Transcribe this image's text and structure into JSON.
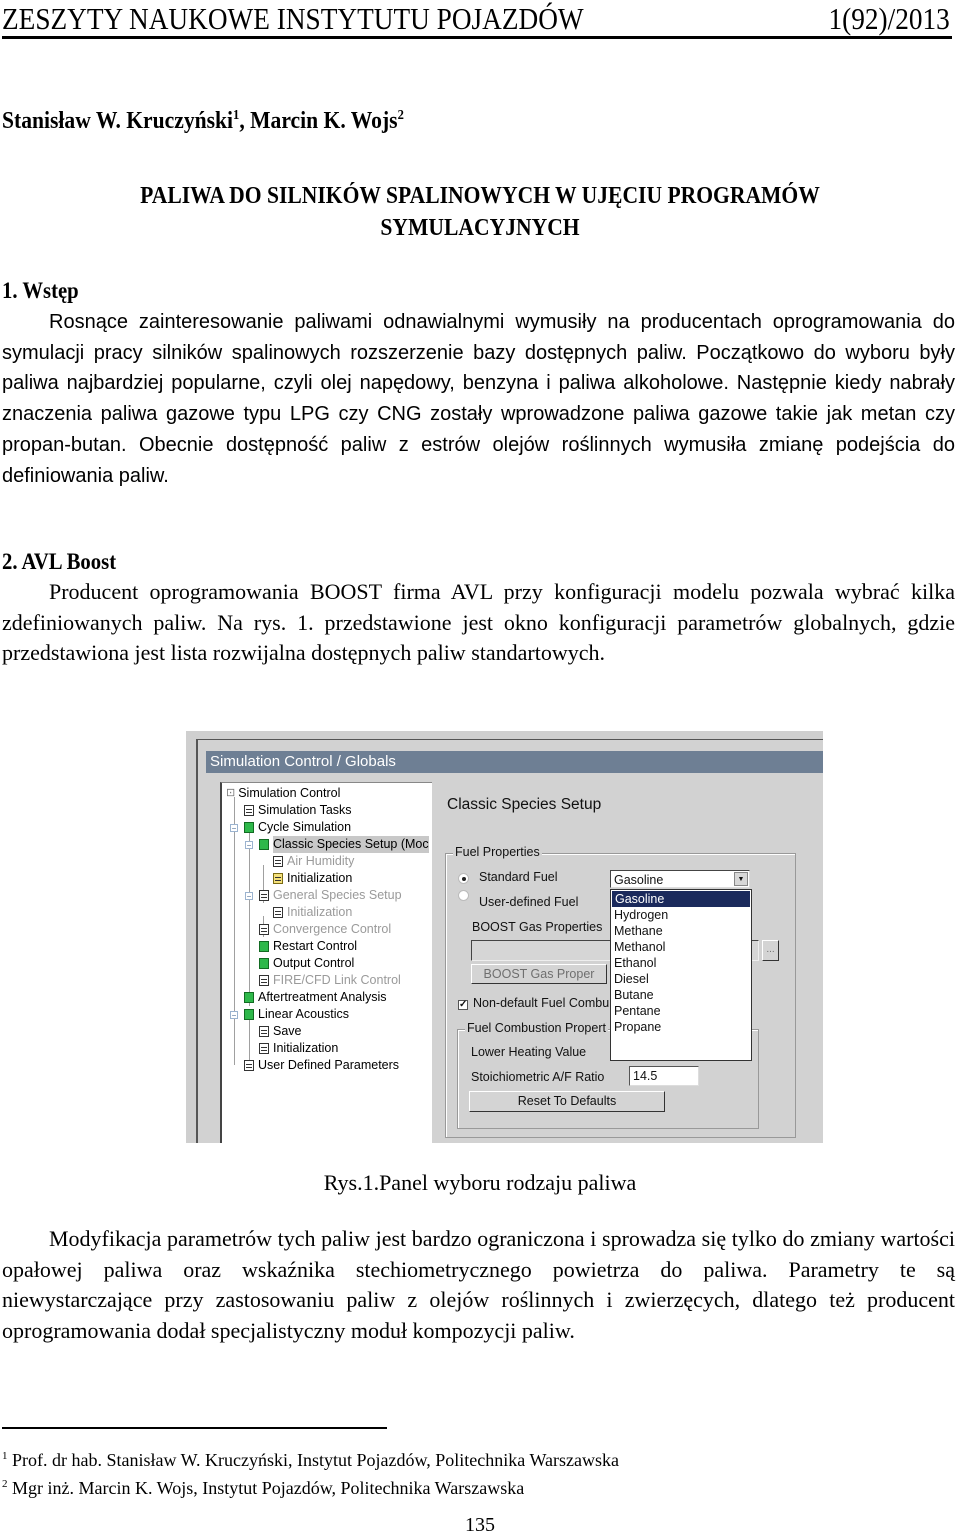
{
  "header": {
    "journal": "ZESZYTY NAUKOWE INSTYTUTU POJAZDÓW",
    "issue": "1(92)/2013"
  },
  "authors": {
    "author1": "Stanisław W. Kruczyński",
    "author1_mark": "1",
    "separator": ", ",
    "author2": "Marcin K. Wojs",
    "author2_mark": "2"
  },
  "title": {
    "line1": "PALIWA DO SILNIKÓW SPALINOWYCH W UJĘCIU PROGRAMÓW",
    "line2": "SYMULACYJNYCH"
  },
  "sections": [
    {
      "heading": "1. Wstęp",
      "text": "Rosnące zainteresowanie paliwami odnawialnymi wymusiły na producentach oprogramowania do symulacji pracy silników spalinowych rozszerzenie bazy dostępnych paliw. Początkowo do wyboru były paliwa najbardziej popularne, czyli olej napędowy, benzyna i paliwa alkoholowe. Następnie kiedy nabrały znaczenia paliwa gazowe typu LPG czy CNG zostały wprowadzone paliwa gazowe takie jak metan czy propan-butan. Obecnie dostępność paliw z estrów olejów roślinnych wymusiła zmianę podejścia do definiowania paliw."
    },
    {
      "heading": "2. AVL Boost",
      "text": "Producent oprogramowania BOOST firma AVL  przy konfiguracji modelu pozwala wybrać kilka zdefiniowanych paliw. Na rys. 1. przedstawione jest okno konfiguracji parametrów globalnych, gdzie przedstawiona jest lista rozwijalna dostępnych paliw standartowych."
    }
  ],
  "figure": {
    "window_title": "Simulation Control / Globals",
    "tree": [
      {
        "label": "Simulation Control",
        "icon": "tree-root-icon",
        "state": "normal"
      },
      {
        "label": "Simulation Tasks",
        "icon": "page-icon",
        "state": "normal"
      },
      {
        "label": "Cycle Simulation",
        "icon": "green-page-icon",
        "state": "normal"
      },
      {
        "label": "Classic Species Setup (Moc",
        "icon": "green-page-icon",
        "state": "selected"
      },
      {
        "label": "Air Humidity",
        "icon": "page-icon",
        "state": "disabled"
      },
      {
        "label": "Initialization",
        "icon": "yellow-table-icon",
        "state": "normal"
      },
      {
        "label": "General Species Setup",
        "icon": "table-icon",
        "state": "disabled"
      },
      {
        "label": "Initialization",
        "icon": "table-icon",
        "state": "disabled"
      },
      {
        "label": "Convergence Control",
        "icon": "table-icon",
        "state": "disabled"
      },
      {
        "label": "Restart Control",
        "icon": "green-page-icon",
        "state": "normal"
      },
      {
        "label": "Output Control",
        "icon": "green-page-icon",
        "state": "normal"
      },
      {
        "label": "FIRE/CFD Link Control",
        "icon": "page-icon",
        "state": "disabled"
      },
      {
        "label": "Aftertreatment Analysis",
        "icon": "green-page-icon",
        "state": "normal"
      },
      {
        "label": "Linear Acoustics",
        "icon": "green-page-icon",
        "state": "normal"
      },
      {
        "label": "Save",
        "icon": "table-icon",
        "state": "normal"
      },
      {
        "label": "Initialization",
        "icon": "table-icon",
        "state": "normal"
      },
      {
        "label": "User Defined Parameters",
        "icon": "table-icon",
        "state": "normal"
      }
    ],
    "panel_title": "Classic Species Setup",
    "fuel_properties": {
      "legend": "Fuel Properties",
      "standard_fuel_label": "Standard Fuel",
      "standard_fuel_selected": true,
      "user_defined_fuel_label": "User-defined Fuel",
      "user_defined_fuel_selected": false,
      "fuel_combo_value": "Gasoline",
      "fuel_options": [
        "Gasoline",
        "Hydrogen",
        "Methane",
        "Methanol",
        "Ethanol",
        "Diesel",
        "Butane",
        "Pentane",
        "Propane"
      ],
      "highlighted_option": "Gasoline",
      "boost_gas_properties_label": "BOOST Gas Properties",
      "boost_gas_properties_path": "",
      "browse_button": "...",
      "boost_gas_button": "BOOST Gas Proper",
      "non_default_checkbox_label": "Non-default Fuel Combu",
      "non_default_checked": true
    },
    "combustion": {
      "legend": "Fuel Combustion Propert",
      "lhv_label": "Lower Heating Value",
      "lhv_value": "",
      "afr_label": "Stoichiometric A/F Ratio",
      "afr_value": "14.5",
      "reset_button": "Reset To Defaults"
    }
  },
  "caption": "Rys.1.Panel wyboru rodzaju paliwa",
  "paragraph3": "Modyfikacja parametrów tych paliw jest bardzo ograniczona i sprowadza się tylko do zmiany wartości opałowej paliwa oraz wskaźnika stechiometrycznego powietrza do paliwa. Parametry te są niewystarczające przy zastosowaniu paliw z olejów roślinnych i zwierzęcych, dlatego też producent oprogramowania dodał specjalistyczny moduł kompozycji paliw.",
  "footnotes": [
    {
      "mark": "1",
      "text": "Prof. dr hab. Stanisław W. Kruczyński, Instytut Pojazdów, Politechnika Warszawska"
    },
    {
      "mark": "2",
      "text": "Mgr inż. Marcin K. Wojs, Instytut Pojazdów, Politechnika Warszawska"
    }
  ],
  "page_number": "135"
}
